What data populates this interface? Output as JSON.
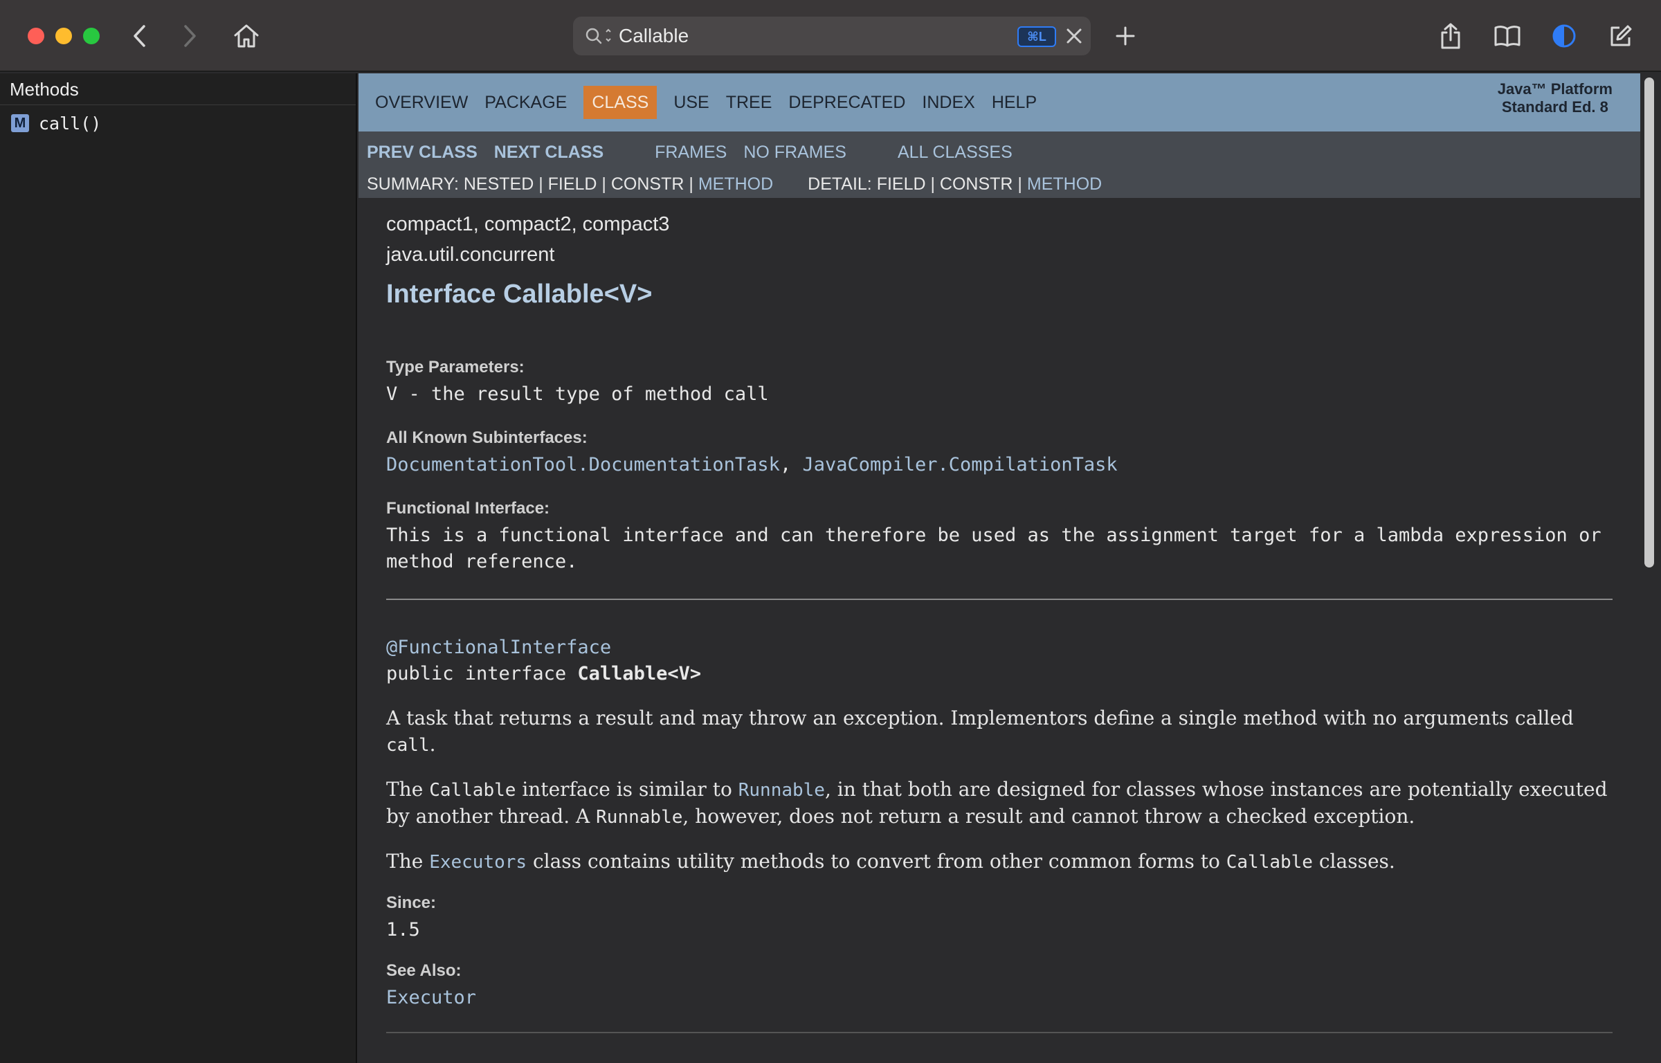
{
  "browser": {
    "address_text": "Callable",
    "shortcut_badge": "⌘L"
  },
  "sidebar": {
    "heading": "Methods",
    "items": [
      {
        "badge": "M",
        "label": "call()"
      }
    ]
  },
  "topnav": {
    "items": [
      "OVERVIEW",
      "PACKAGE",
      "CLASS",
      "USE",
      "TREE",
      "DEPRECATED",
      "INDEX",
      "HELP"
    ],
    "active": "CLASS",
    "brand_line1": "Java™ Platform",
    "brand_line2": "Standard Ed. 8"
  },
  "subnav": {
    "prev_class": "PREV CLASS",
    "next_class": "NEXT CLASS",
    "frames": "FRAMES",
    "no_frames": "NO FRAMES",
    "all_classes": "ALL CLASSES",
    "summary_prefix": "SUMMARY: NESTED | FIELD | CONSTR | ",
    "summary_method": "METHOD",
    "detail_prefix": "DETAIL: FIELD | CONSTR | ",
    "detail_method": "METHOD"
  },
  "doc": {
    "profiles": "compact1, compact2, compact3",
    "package": "java.util.concurrent",
    "title": "Interface Callable<V>",
    "type_params_label": "Type Parameters:",
    "type_params_value": "V - the result type of method call",
    "subinterfaces_label": "All Known Subinterfaces:",
    "subinterface_1": "DocumentationTool.DocumentationTask",
    "subinterface_sep": ", ",
    "subinterface_2": "JavaCompiler.CompilationTask",
    "functional_label": "Functional Interface:",
    "functional_text": "This is a functional interface and can therefore be used as the assignment target for a lambda expression or method reference.",
    "annotation": "@FunctionalInterface",
    "decl_prefix": "public interface ",
    "decl_name": "Callable<V>",
    "para1_a": "A task that returns a result and may throw an exception. Implementors define a single method with no arguments called ",
    "para1_code": "call",
    "para1_b": ".",
    "para2_a": "The ",
    "para2_code1": "Callable",
    "para2_b": " interface is similar to ",
    "para2_link": "Runnable",
    "para2_c": ", in that both are designed for classes whose instances are potentially executed by another thread. A ",
    "para2_code2": "Runnable",
    "para2_d": ", however, does not return a result and cannot throw a checked exception.",
    "para3_a": "The ",
    "para3_link": "Executors",
    "para3_b": " class contains utility methods to convert from other common forms to ",
    "para3_code": "Callable",
    "para3_c": " classes.",
    "since_label": "Since:",
    "since_value": "1.5",
    "see_also_label": "See Also:",
    "see_also_link": "Executor"
  }
}
